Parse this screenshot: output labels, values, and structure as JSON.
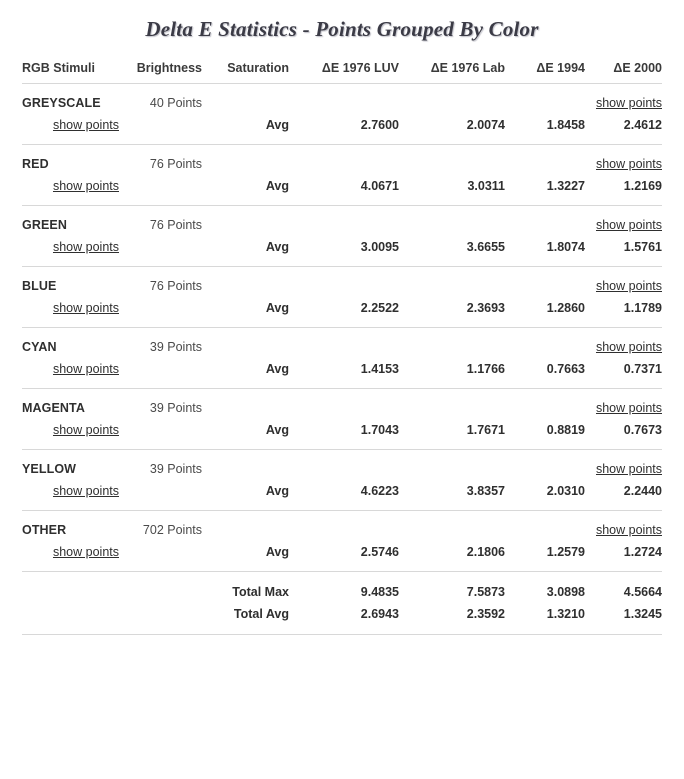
{
  "title": "Delta E Statistics - Points Grouped By Color",
  "columns": [
    "RGB Stimuli",
    "Brightness",
    "Saturation",
    "ΔE 1976 LUV",
    "ΔE 1976 Lab",
    "ΔE 1994",
    "ΔE 2000"
  ],
  "labels": {
    "show_points": "show points",
    "avg": "Avg",
    "total_max": "Total Max",
    "total_avg": "Total Avg"
  },
  "colors": {
    "text": "#2f2f2f",
    "muted": "#4a4a4a",
    "rule": "#d8d8d8",
    "title": "#3b3b46",
    "background": "#ffffff"
  },
  "groups": [
    {
      "name": "GREYSCALE",
      "points": "40 Points",
      "show_points_group": "show points",
      "show_points_row": "show points",
      "stat": "Avg",
      "values": [
        "2.7600",
        "2.0074",
        "1.8458",
        "2.4612"
      ]
    },
    {
      "name": "RED",
      "points": "76 Points",
      "show_points_group": "show points",
      "show_points_row": "show points",
      "stat": "Avg",
      "values": [
        "4.0671",
        "3.0311",
        "1.3227",
        "1.2169"
      ]
    },
    {
      "name": "GREEN",
      "points": "76 Points",
      "show_points_group": "show points",
      "show_points_row": "show points",
      "stat": "Avg",
      "values": [
        "3.0095",
        "3.6655",
        "1.8074",
        "1.5761"
      ]
    },
    {
      "name": "BLUE",
      "points": "76 Points",
      "show_points_group": "show points",
      "show_points_row": "show points",
      "stat": "Avg",
      "values": [
        "2.2522",
        "2.3693",
        "1.2860",
        "1.1789"
      ]
    },
    {
      "name": "CYAN",
      "points": "39 Points",
      "show_points_group": "show points",
      "show_points_row": "show points",
      "stat": "Avg",
      "values": [
        "1.4153",
        "1.1766",
        "0.7663",
        "0.7371"
      ]
    },
    {
      "name": "MAGENTA",
      "points": "39 Points",
      "show_points_group": "show points",
      "show_points_row": "show points",
      "stat": "Avg",
      "values": [
        "1.7043",
        "1.7671",
        "0.8819",
        "0.7673"
      ]
    },
    {
      "name": "YELLOW",
      "points": "39 Points",
      "show_points_group": "show points",
      "show_points_row": "show points",
      "stat": "Avg",
      "values": [
        "4.6223",
        "3.8357",
        "2.0310",
        "2.2440"
      ]
    },
    {
      "name": "OTHER",
      "points": "702 Points",
      "show_points_group": "show points",
      "show_points_row": "show points",
      "stat": "Avg",
      "values": [
        "2.5746",
        "2.1806",
        "1.2579",
        "1.2724"
      ]
    }
  ],
  "totals": [
    {
      "label": "Total Max",
      "values": [
        "9.4835",
        "7.5873",
        "3.0898",
        "4.5664"
      ]
    },
    {
      "label": "Total Avg",
      "values": [
        "2.6943",
        "2.3592",
        "1.3210",
        "1.3245"
      ]
    }
  ]
}
